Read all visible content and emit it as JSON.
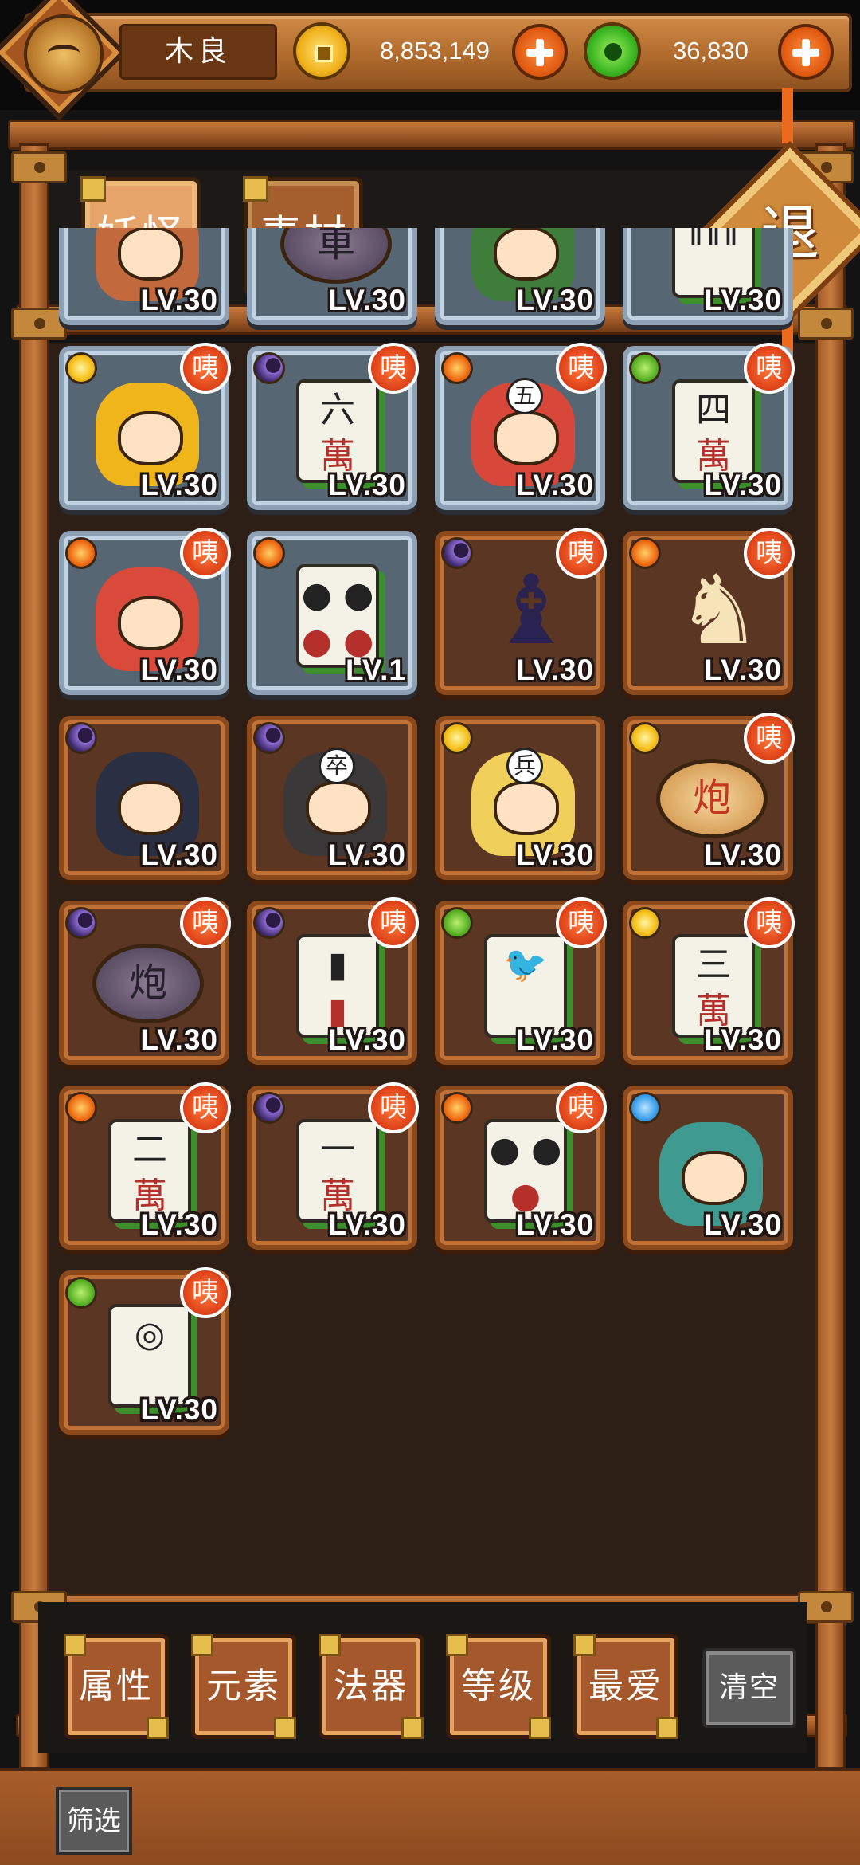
{
  "header": {
    "player_name": "木良",
    "gold_amount": "8,853,149",
    "jade_amount": "36,830",
    "gold_icon": "gold-coin-icon",
    "jade_icon": "jade-coin-icon"
  },
  "tabs": [
    {
      "label": "妖怪",
      "active": true
    },
    {
      "label": "素材",
      "active": false
    }
  ],
  "exit_label": "退",
  "badge_label": "咦",
  "grid": {
    "rows": [
      [
        {
          "level": "LV.30",
          "frame": "blue",
          "element": null,
          "badge": false,
          "art": "chara",
          "art_text": "",
          "art_color": "#c26a3e"
        },
        {
          "level": "LV.30",
          "frame": "blue",
          "element": null,
          "badge": false,
          "art": "piece-dark",
          "art_text": "車",
          "art_color": ""
        },
        {
          "level": "LV.30",
          "frame": "blue",
          "element": null,
          "badge": false,
          "art": "chara",
          "art_text": "",
          "art_color": "#3e7d3a"
        },
        {
          "level": "LV.30",
          "frame": "blue",
          "element": null,
          "badge": false,
          "art": "tile",
          "art_text": "‖‖‖",
          "art_sub": "",
          "art_color": ""
        }
      ],
      [
        {
          "level": "LV.30",
          "frame": "blue",
          "element": "sun",
          "badge": true,
          "art": "chara",
          "art_text": "",
          "art_color": "#f1b51c"
        },
        {
          "level": "LV.30",
          "frame": "blue",
          "element": "moon",
          "badge": true,
          "art": "tile",
          "art_text": "六",
          "art_sub": "萬",
          "art_color": ""
        },
        {
          "level": "LV.30",
          "frame": "blue",
          "element": "fire",
          "badge": true,
          "art": "chara",
          "art_text": "五",
          "art_color": "#d7483a"
        },
        {
          "level": "LV.30",
          "frame": "blue",
          "element": "leaf",
          "badge": true,
          "art": "tile",
          "art_text": "四",
          "art_sub": "萬",
          "art_color": ""
        }
      ],
      [
        {
          "level": "LV.30",
          "frame": "blue",
          "element": "fire",
          "badge": true,
          "art": "chara",
          "art_text": "",
          "art_color": "#d94a3b"
        },
        {
          "level": "LV.1",
          "frame": "blue",
          "element": "fire",
          "badge": false,
          "art": "tile",
          "art_text": "● ●",
          "art_sub": "● ●",
          "art_color": ""
        },
        {
          "level": "LV.30",
          "frame": "brown",
          "element": "moon",
          "badge": true,
          "art": "chess",
          "art_text": "♝",
          "art_color": "#2a2250"
        },
        {
          "level": "LV.30",
          "frame": "brown",
          "element": "fire",
          "badge": true,
          "art": "chess",
          "art_text": "♞",
          "art_color": "#f7e3b8"
        }
      ],
      [
        {
          "level": "LV.30",
          "frame": "brown",
          "element": "moon",
          "badge": false,
          "art": "chara",
          "art_text": "",
          "art_color": "#2a3044"
        },
        {
          "level": "LV.30",
          "frame": "brown",
          "element": "moon",
          "badge": false,
          "art": "chara",
          "art_text": "卒",
          "art_color": "#3a3838"
        },
        {
          "level": "LV.30",
          "frame": "brown",
          "element": "sun",
          "badge": false,
          "art": "chara",
          "art_text": "兵",
          "art_color": "#f0cf5a"
        },
        {
          "level": "LV.30",
          "frame": "brown",
          "element": "sun",
          "badge": true,
          "art": "piece",
          "art_text": "炮",
          "art_color": ""
        }
      ],
      [
        {
          "level": "LV.30",
          "frame": "brown",
          "element": "moon",
          "badge": true,
          "art": "piece-dark",
          "art_text": "炮",
          "art_color": ""
        },
        {
          "level": "LV.30",
          "frame": "brown",
          "element": "moon",
          "badge": true,
          "art": "tile",
          "art_text": "▮",
          "art_sub": "▮",
          "art_color": ""
        },
        {
          "level": "LV.30",
          "frame": "brown",
          "element": "leaf",
          "badge": true,
          "art": "tile",
          "art_text": "🐦",
          "art_sub": "",
          "art_color": ""
        },
        {
          "level": "LV.30",
          "frame": "brown",
          "element": "sun",
          "badge": true,
          "art": "tile",
          "art_text": "三",
          "art_sub": "萬",
          "art_color": ""
        }
      ],
      [
        {
          "level": "LV.30",
          "frame": "brown",
          "element": "fire",
          "badge": true,
          "art": "tile",
          "art_text": "二",
          "art_sub": "萬",
          "art_color": ""
        },
        {
          "level": "LV.30",
          "frame": "brown",
          "element": "moon",
          "badge": true,
          "art": "tile",
          "art_text": "一",
          "art_sub": "萬",
          "art_color": ""
        },
        {
          "level": "LV.30",
          "frame": "brown",
          "element": "fire",
          "badge": true,
          "art": "tile",
          "art_text": "● ●",
          "art_sub": "●",
          "art_color": ""
        },
        {
          "level": "LV.30",
          "frame": "brown",
          "element": "water",
          "badge": false,
          "art": "chara",
          "art_text": "",
          "art_color": "#3f9b8f"
        }
      ],
      [
        {
          "level": "LV.30",
          "frame": "brown",
          "element": "leaf",
          "badge": true,
          "art": "tile",
          "art_text": "◎",
          "art_sub": "",
          "art_color": ""
        }
      ]
    ]
  },
  "filters": [
    "属性",
    "元素",
    "法器",
    "等级",
    "最爱"
  ],
  "clear_label": "清空",
  "screen_label": "筛选"
}
